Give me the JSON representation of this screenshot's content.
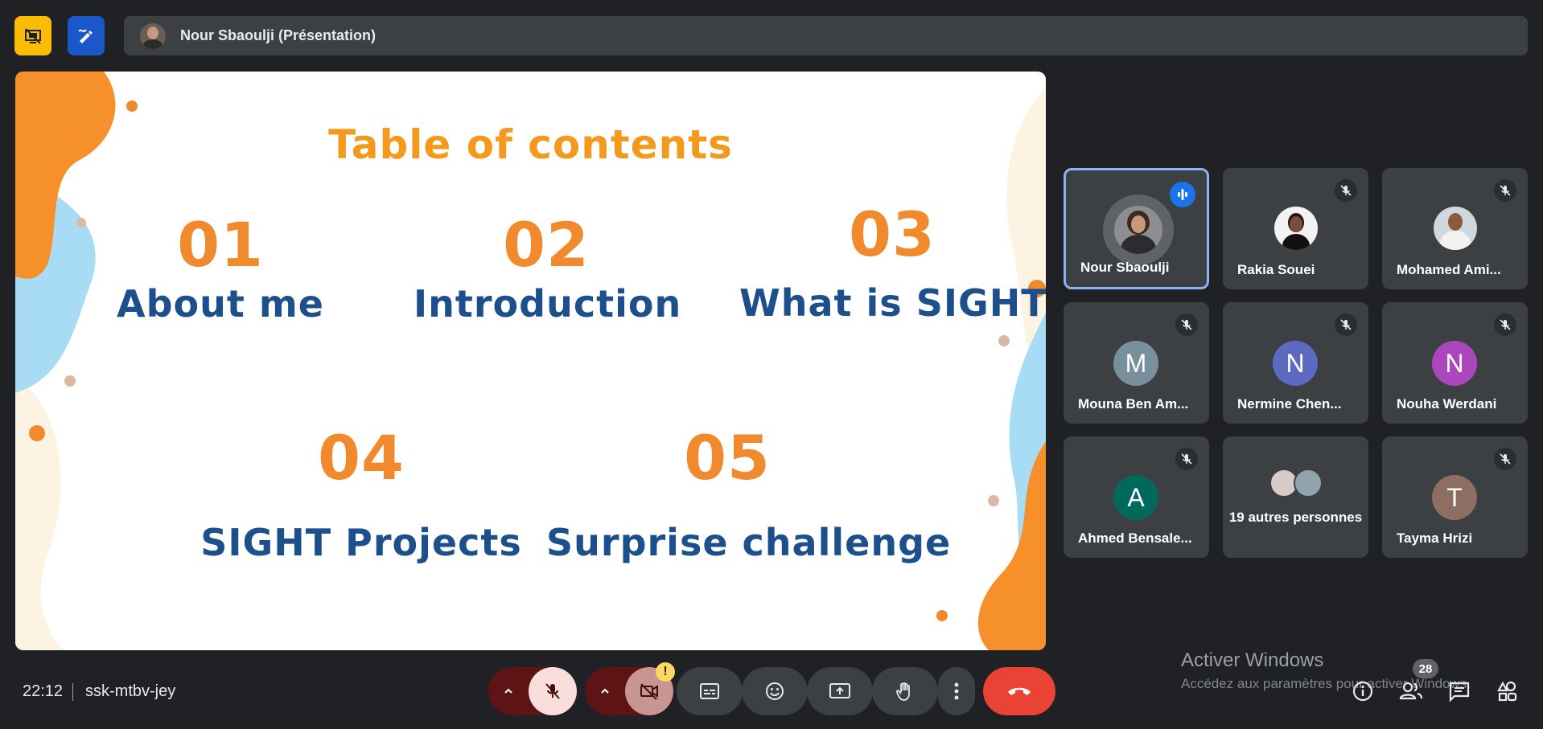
{
  "top_bar": {
    "presenter_label": "Nour Sbaoulji (Présentation)"
  },
  "slide": {
    "title": "Table of contents",
    "items": [
      {
        "num": "01",
        "label": "About me"
      },
      {
        "num": "02",
        "label": "Introduction"
      },
      {
        "num": "03",
        "label": "What is SIGHT"
      },
      {
        "num": "04",
        "label": "SIGHT Projects"
      },
      {
        "num": "05",
        "label": "Surprise challenge"
      }
    ],
    "colors": {
      "title": "#f39a1e",
      "number": "#f08a2c",
      "label": "#1c4f8c",
      "blob_orange": "#f5902b",
      "blob_blue": "#a8dcf5",
      "blob_cream": "#fcf3e3"
    }
  },
  "participants": [
    {
      "name": "Nour Sbaoulji",
      "avatar": "photo",
      "state": "speaking"
    },
    {
      "name": "Rakia Souei",
      "avatar": "photo",
      "state": "muted"
    },
    {
      "name": "Mohamed Ami...",
      "avatar": "photo",
      "state": "muted"
    },
    {
      "name": "Mouna Ben Am...",
      "initial": "M",
      "color": "#78909c",
      "state": "muted"
    },
    {
      "name": "Nermine Chen...",
      "initial": "N",
      "color": "#5c6bc0",
      "state": "muted"
    },
    {
      "name": "Nouha Werdani",
      "initial": "N",
      "color": "#ab47bc",
      "state": "muted"
    },
    {
      "name": "Ahmed Bensale...",
      "initial": "A",
      "color": "#00695c",
      "state": "muted"
    },
    {
      "name": "19 autres personnes",
      "avatar": "group"
    },
    {
      "name": "Tayma Hrizi",
      "initial": "T",
      "color": "#8d6e63",
      "state": "muted"
    }
  ],
  "bottom_bar": {
    "time": "22:12",
    "meeting_code": "ssk-mtbv-jey",
    "camera_warning": "!",
    "people_count": "28"
  },
  "windows_activation": {
    "title": "Activer Windows",
    "subtitle": "Accédez aux paramètres pour activer Windows."
  },
  "icons": [
    "present-off-icon",
    "whiteboard-icon",
    "mic-off-icon",
    "camera-off-icon",
    "captions-icon",
    "emoji-icon",
    "present-screen-icon",
    "raise-hand-icon",
    "more-vert-icon",
    "end-call-icon",
    "info-icon",
    "people-icon",
    "chat-icon",
    "activities-icon"
  ]
}
